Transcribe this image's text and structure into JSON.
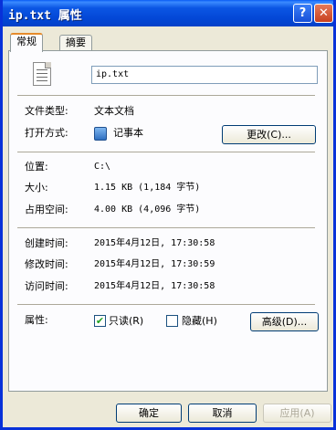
{
  "window": {
    "title": "ip.txt 属性",
    "help_button": "?",
    "close_button": "✕"
  },
  "tabs": [
    {
      "label": "常规",
      "active": true
    },
    {
      "label": "摘要",
      "active": false
    }
  ],
  "file": {
    "name": "ip.txt",
    "icon": "text-file-icon"
  },
  "info": {
    "type_label": "文件类型:",
    "type_value": "文本文档",
    "open_with_label": "打开方式:",
    "open_with_value": "记事本",
    "open_with_icon": "notepad-icon",
    "change_button": "更改(C)...",
    "location_label": "位置:",
    "location_value": "C:\\",
    "size_label": "大小:",
    "size_value": "1.15 KB (1,184 字节)",
    "disk_label": "占用空间:",
    "disk_value": "4.00 KB (4,096 字节)",
    "created_label": "创建时间:",
    "created_value": "2015年4月12日, 17:30:58",
    "modified_label": "修改时间:",
    "modified_value": "2015年4月12日, 17:30:59",
    "accessed_label": "访问时间:",
    "accessed_value": "2015年4月12日, 17:30:58",
    "attributes_label": "属性:",
    "readonly_label": "只读(R)",
    "readonly_checked": true,
    "hidden_label": "隐藏(H)",
    "hidden_checked": false,
    "advanced_button": "高级(D)..."
  },
  "footer": {
    "ok": "确定",
    "cancel": "取消",
    "apply": "应用(A)"
  }
}
